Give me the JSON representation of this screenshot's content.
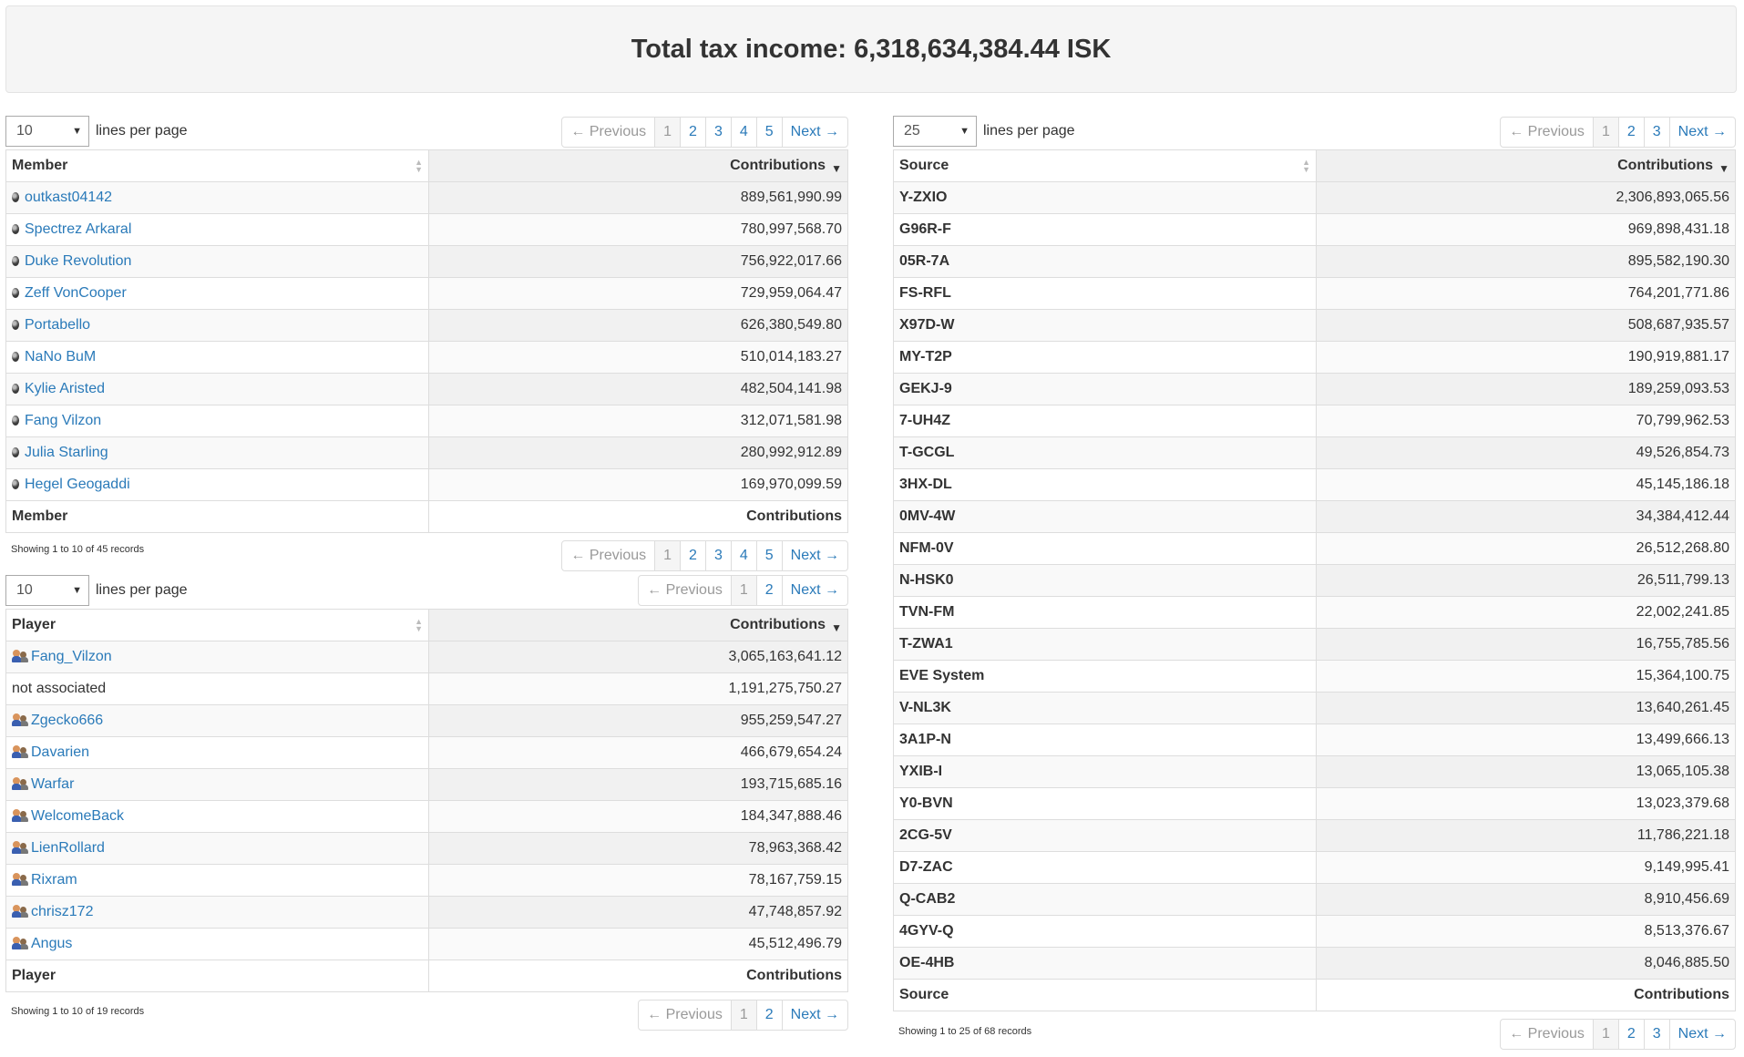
{
  "header": {
    "title": "Total tax income: 6,318,634,384.44 ISK"
  },
  "members": {
    "length_value": "10",
    "length_label": "lines per page",
    "pager_top": [
      "← Previous",
      "1",
      "2",
      "3",
      "4",
      "5",
      "Next →"
    ],
    "columns": [
      "Member",
      "Contributions"
    ],
    "rows": [
      {
        "name": "outkast04142",
        "value": "889,561,990.99"
      },
      {
        "name": "Spectrez Arkaral",
        "value": "780,997,568.70"
      },
      {
        "name": "Duke Revolution",
        "value": "756,922,017.66"
      },
      {
        "name": "Zeff VonCooper",
        "value": "729,959,064.47"
      },
      {
        "name": "Portabello",
        "value": "626,380,549.80"
      },
      {
        "name": "NaNo BuM",
        "value": "510,014,183.27"
      },
      {
        "name": "Kylie Aristed",
        "value": "482,504,141.98"
      },
      {
        "name": "Fang Vilzon",
        "value": "312,071,581.98"
      },
      {
        "name": "Julia Starling",
        "value": "280,992,912.89"
      },
      {
        "name": "Hegel Geogaddi",
        "value": "169,970,099.59"
      }
    ],
    "footer": [
      "Member",
      "Contributions"
    ],
    "info": "Showing 1 to 10 of 45 records",
    "pager_bottom": [
      "← Previous",
      "1",
      "2",
      "3",
      "4",
      "5",
      "Next →"
    ]
  },
  "players": {
    "length_value": "10",
    "length_label": "lines per page",
    "pager_top": [
      "← Previous",
      "1",
      "2",
      "Next →"
    ],
    "columns": [
      "Player",
      "Contributions"
    ],
    "rows": [
      {
        "name": "Fang_Vilzon",
        "value": "3,065,163,641.12",
        "link": true
      },
      {
        "name": "not associated",
        "value": "1,191,275,750.27",
        "link": false
      },
      {
        "name": "Zgecko666",
        "value": "955,259,547.27",
        "link": true
      },
      {
        "name": "Davarien",
        "value": "466,679,654.24",
        "link": true
      },
      {
        "name": "Warfar",
        "value": "193,715,685.16",
        "link": true
      },
      {
        "name": "WelcomeBack",
        "value": "184,347,888.46",
        "link": true
      },
      {
        "name": "LienRollard",
        "value": "78,963,368.42",
        "link": true
      },
      {
        "name": "Rixram",
        "value": "78,167,759.15",
        "link": true
      },
      {
        "name": "chrisz172",
        "value": "47,748,857.92",
        "link": true
      },
      {
        "name": "Angus",
        "value": "45,512,496.79",
        "link": true
      }
    ],
    "footer": [
      "Player",
      "Contributions"
    ],
    "info": "Showing 1 to 10 of 19 records",
    "pager_bottom": [
      "← Previous",
      "1",
      "2",
      "Next →"
    ]
  },
  "sources": {
    "length_value": "25",
    "length_label": "lines per page",
    "pager_top": [
      "← Previous",
      "1",
      "2",
      "3",
      "Next →"
    ],
    "columns": [
      "Source",
      "Contributions"
    ],
    "rows": [
      {
        "name": "Y-ZXIO",
        "value": "2,306,893,065.56"
      },
      {
        "name": "G96R-F",
        "value": "969,898,431.18"
      },
      {
        "name": "05R-7A",
        "value": "895,582,190.30"
      },
      {
        "name": "FS-RFL",
        "value": "764,201,771.86"
      },
      {
        "name": "X97D-W",
        "value": "508,687,935.57"
      },
      {
        "name": "MY-T2P",
        "value": "190,919,881.17"
      },
      {
        "name": "GEKJ-9",
        "value": "189,259,093.53"
      },
      {
        "name": "7-UH4Z",
        "value": "70,799,962.53"
      },
      {
        "name": "T-GCGL",
        "value": "49,526,854.73"
      },
      {
        "name": "3HX-DL",
        "value": "45,145,186.18"
      },
      {
        "name": "0MV-4W",
        "value": "34,384,412.44"
      },
      {
        "name": "NFM-0V",
        "value": "26,512,268.80"
      },
      {
        "name": "N-HSK0",
        "value": "26,511,799.13"
      },
      {
        "name": "TVN-FM",
        "value": "22,002,241.85"
      },
      {
        "name": "T-ZWA1",
        "value": "16,755,785.56"
      },
      {
        "name": "EVE System",
        "value": "15,364,100.75"
      },
      {
        "name": "V-NL3K",
        "value": "13,640,261.45"
      },
      {
        "name": "3A1P-N",
        "value": "13,499,666.13"
      },
      {
        "name": "YXIB-I",
        "value": "13,065,105.38"
      },
      {
        "name": "Y0-BVN",
        "value": "13,023,379.68"
      },
      {
        "name": "2CG-5V",
        "value": "11,786,221.18"
      },
      {
        "name": "D7-ZAC",
        "value": "9,149,995.41"
      },
      {
        "name": "Q-CAB2",
        "value": "8,910,456.69"
      },
      {
        "name": "4GYV-Q",
        "value": "8,513,376.67"
      },
      {
        "name": "OE-4HB",
        "value": "8,046,885.50"
      }
    ],
    "footer": [
      "Source",
      "Contributions"
    ],
    "info": "Showing 1 to 25 of 68 records",
    "pager_bottom": [
      "← Previous",
      "1",
      "2",
      "3",
      "Next →"
    ]
  }
}
